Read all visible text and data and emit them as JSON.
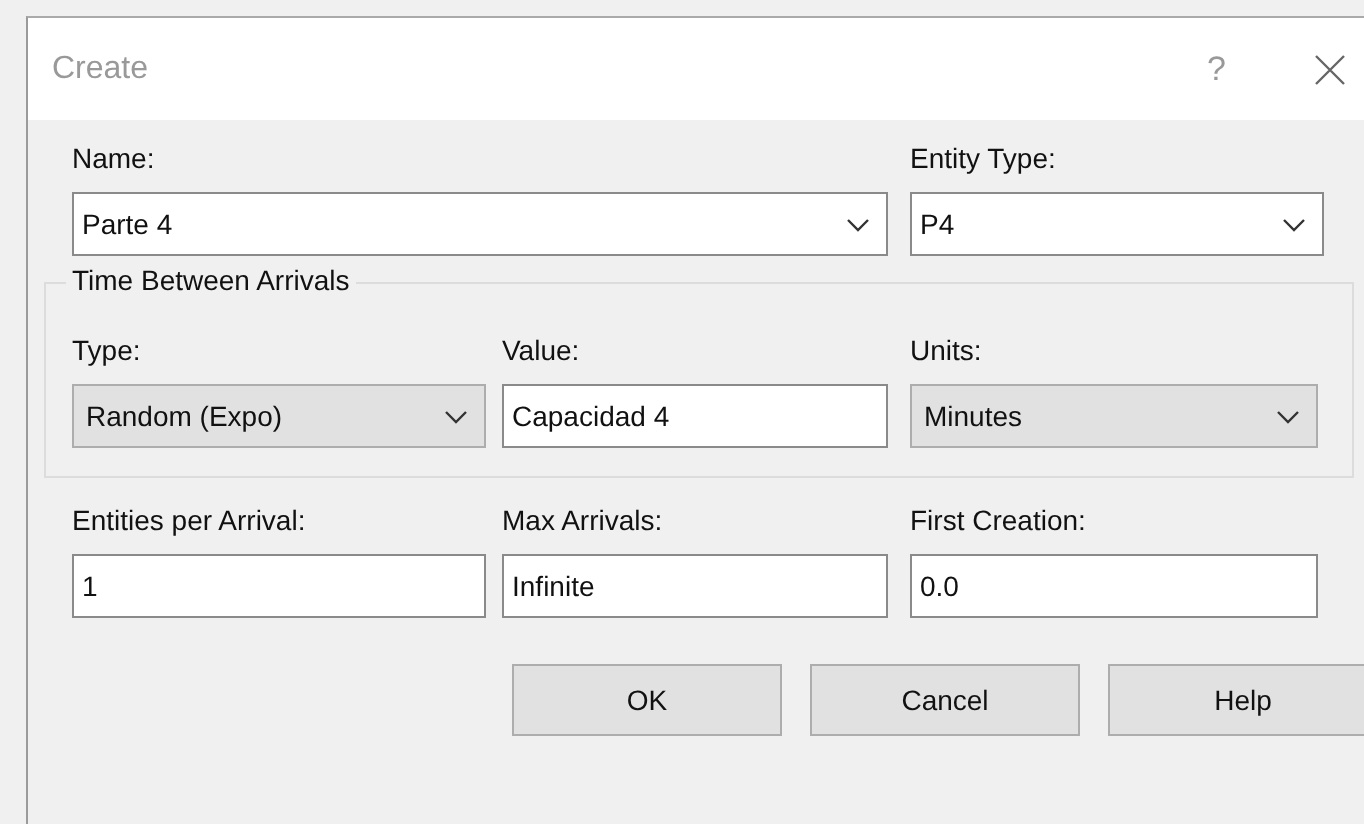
{
  "window": {
    "title": "Create",
    "help_glyph": "?"
  },
  "top_fields": [
    {
      "label": "Name:",
      "kind": "combo",
      "value": "Parte 4"
    },
    {
      "label": "Entity Type:",
      "kind": "combo",
      "value": "P4"
    }
  ],
  "group": {
    "title": "Time Between Arrivals",
    "fields": [
      {
        "label": "Type:",
        "kind": "dropdown",
        "value": "Random (Expo)"
      },
      {
        "label": "Value:",
        "kind": "text",
        "value": "Capacidad 4"
      },
      {
        "label": "Units:",
        "kind": "dropdown",
        "value": "Minutes"
      }
    ]
  },
  "bottom_fields": [
    {
      "label": "Entities per Arrival:",
      "kind": "text",
      "value": "1"
    },
    {
      "label": "Max Arrivals:",
      "kind": "text",
      "value": "Infinite"
    },
    {
      "label": "First Creation:",
      "kind": "text",
      "value": "0.0"
    }
  ],
  "buttons": [
    "OK",
    "Cancel",
    "Help"
  ]
}
